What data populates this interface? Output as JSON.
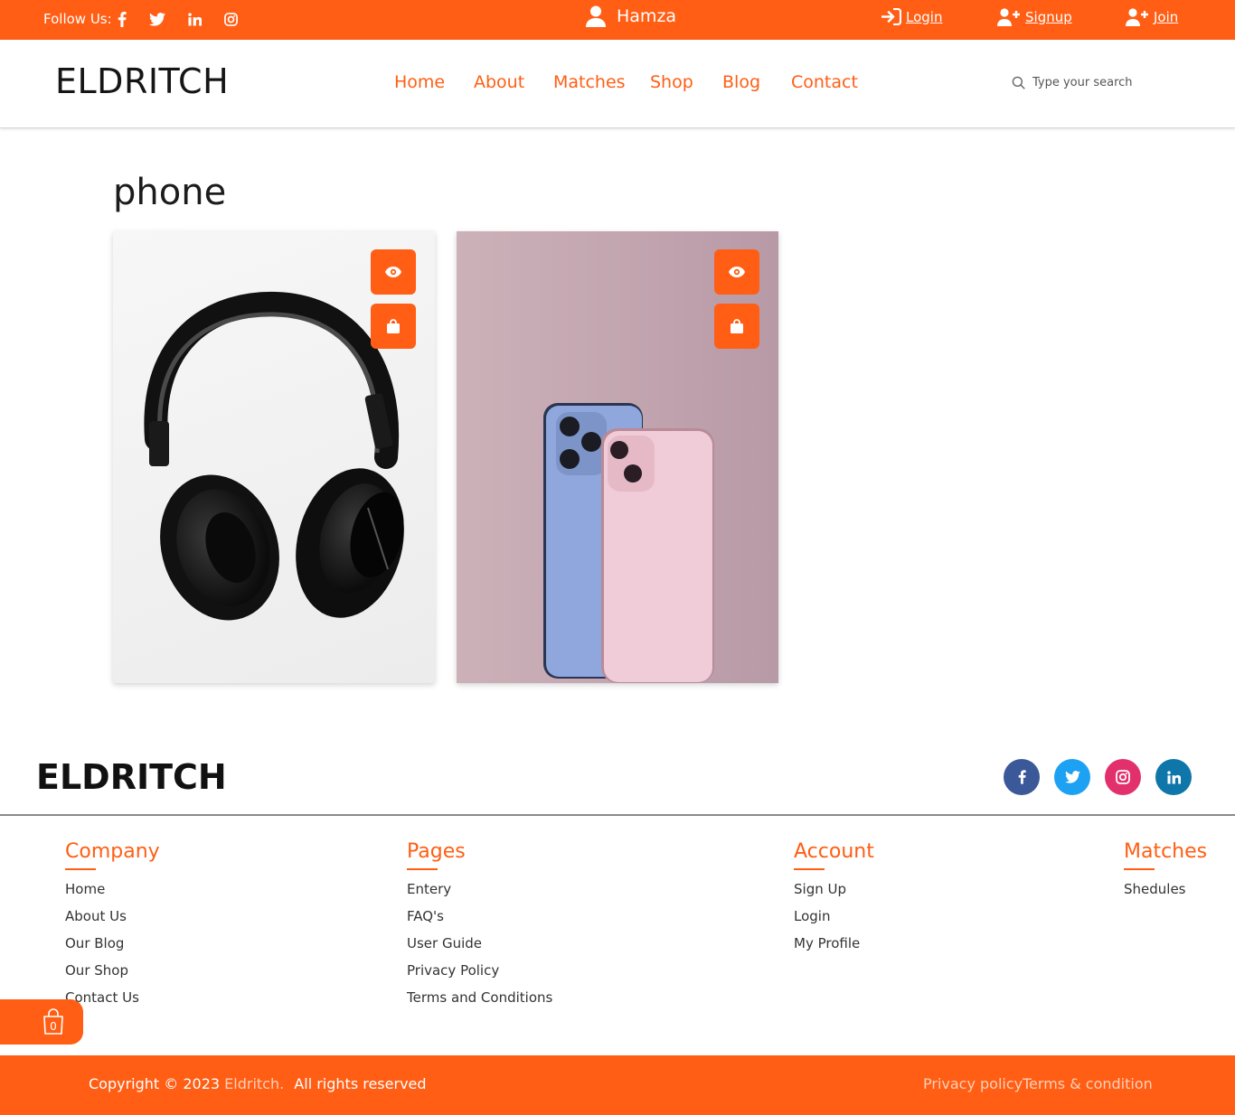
{
  "topbar": {
    "follow_label": "Follow Us:",
    "social_icons": [
      "facebook-icon",
      "twitter-icon",
      "linkedin-icon",
      "instagram-icon"
    ],
    "username": "Hamza",
    "login": "Login",
    "signup": "Signup",
    "join": "Join",
    "bg_color": "#ff5e14"
  },
  "header": {
    "logo": "ELDRITCH",
    "nav": [
      "Home",
      "About",
      "Matches",
      "Shop",
      "Blog",
      "Contact"
    ],
    "search_placeholder": "Type your search"
  },
  "main": {
    "title": "phone",
    "products": [
      {
        "image": "headphones",
        "actions": [
          "eye-icon",
          "shopping-bag-icon"
        ]
      },
      {
        "image": "phones",
        "actions": [
          "eye-icon",
          "shopping-bag-icon"
        ]
      }
    ]
  },
  "footer": {
    "logo": "ELDRITCH",
    "social": [
      {
        "icon": "facebook-icon",
        "color": "#3b5998"
      },
      {
        "icon": "twitter-icon",
        "color": "#1da1f2"
      },
      {
        "icon": "instagram-icon",
        "color": "#e1306c"
      },
      {
        "icon": "linkedin-icon",
        "color": "#0e76a8"
      }
    ],
    "columns": [
      {
        "title": "Company",
        "links": [
          "Home",
          "About Us",
          "Our Blog",
          "Our Shop",
          "Contact Us"
        ]
      },
      {
        "title": "Pages",
        "links": [
          "Entery",
          "FAQ's",
          "User Guide",
          "Privacy Policy",
          "Terms and Conditions"
        ]
      },
      {
        "title": "Account",
        "links": [
          "Sign Up",
          "Login",
          "My Profile"
        ]
      },
      {
        "title": "Matches",
        "links": [
          "Shedules"
        ]
      }
    ],
    "cart_count": "0",
    "copyright_prefix": "Copyright © 2023",
    "copyright_brand": "Eldritch.",
    "copyright_suffix": "All rights reserved",
    "privacy": "Privacy policy",
    "terms": "Terms & condition"
  }
}
